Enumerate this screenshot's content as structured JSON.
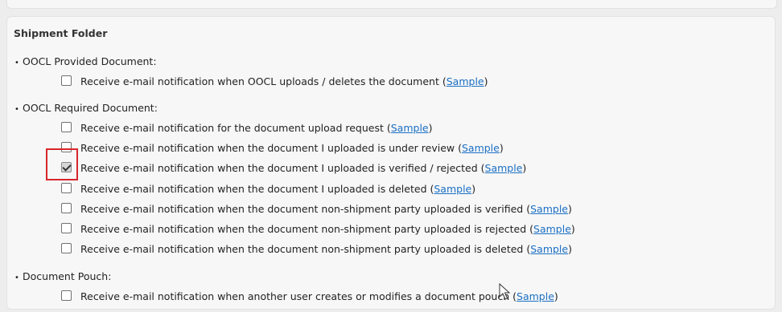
{
  "folder": {
    "title": "Shipment Folder",
    "sections": [
      {
        "label": "OOCL Provided Document:",
        "options": [
          {
            "text": "Receive e-mail notification when OOCL uploads / deletes the document",
            "link": "Sample",
            "checked": false
          }
        ]
      },
      {
        "label": "OOCL Required Document:",
        "options": [
          {
            "text": "Receive e-mail notification for the document upload request",
            "link": "Sample",
            "checked": false
          },
          {
            "text": "Receive e-mail notification when the document I uploaded is under review",
            "link": "Sample",
            "checked": false
          },
          {
            "text": "Receive e-mail notification when the document I uploaded is verified / rejected",
            "link": "Sample",
            "checked": true
          },
          {
            "text": "Receive e-mail notification when the document I uploaded is deleted",
            "link": "Sample",
            "checked": false
          },
          {
            "text": "Receive e-mail notification when the document non-shipment party uploaded is verified",
            "link": "Sample",
            "checked": false
          },
          {
            "text": "Receive e-mail notification when the document non-shipment party uploaded is rejected",
            "link": "Sample",
            "checked": false
          },
          {
            "text": "Receive e-mail notification when the document non-shipment party uploaded is deleted",
            "link": "Sample",
            "checked": false
          }
        ]
      },
      {
        "label": "Document Pouch:",
        "options": [
          {
            "text": "Receive e-mail notification when another user creates or modifies a document pouch",
            "link": "Sample",
            "checked": false
          }
        ]
      }
    ]
  },
  "colors": {
    "link": "#1a6fc4",
    "highlight": "#d7262b"
  }
}
